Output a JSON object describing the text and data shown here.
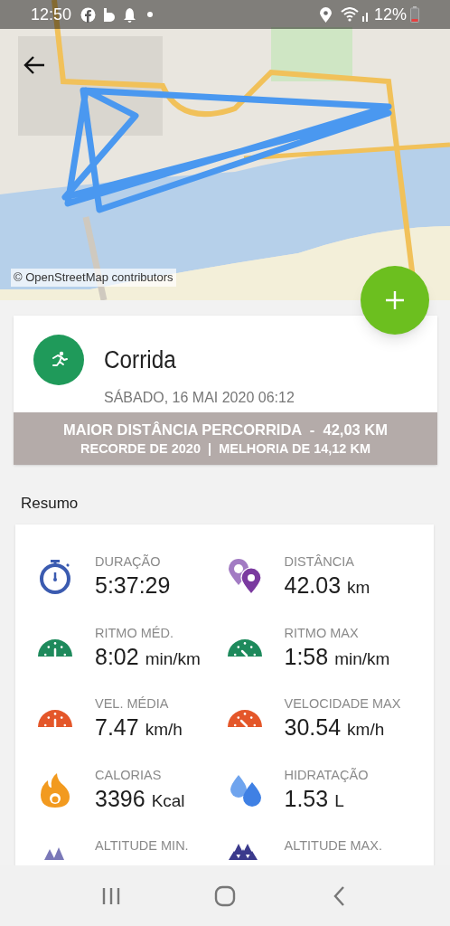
{
  "status_bar": {
    "time": "12:50",
    "battery": "12%"
  },
  "map": {
    "attribution": "© OpenStreetMap contributors"
  },
  "activity": {
    "title": "Corrida",
    "date": "SÁBADO, 16 MAI 2020 06:12",
    "record": {
      "headline": "MAIOR DISTÂNCIA PERCORRIDA  -  42,03 KM",
      "detail": "RECORDE DE 2020  |  MELHORIA DE 14,12 KM"
    }
  },
  "summary": {
    "title": "Resumo",
    "stats": [
      {
        "kind": "duration",
        "label": "DURAÇÃO",
        "value": "5:37:29"
      },
      {
        "kind": "distance",
        "label": "DISTÂNCIA",
        "value": "42.03",
        "unit": "km"
      },
      {
        "kind": "pace",
        "label": "RITMO MÉD.",
        "value": "8:02",
        "unit": "min/km"
      },
      {
        "kind": "pace_max",
        "label": "RITMO MAX",
        "value": "1:58",
        "unit": "min/km"
      },
      {
        "kind": "speed",
        "label": "VEL. MÉDIA",
        "value": "7.47",
        "unit": "km/h"
      },
      {
        "kind": "speed_max",
        "label": "VELOCIDADE MAX",
        "value": "30.54",
        "unit": "km/h"
      },
      {
        "kind": "calories",
        "label": "CALORIAS",
        "value": "3396",
        "unit": "Kcal"
      },
      {
        "kind": "hydration",
        "label": "HIDRATAÇÃO",
        "value": "1.53",
        "unit": "L"
      },
      {
        "kind": "altitude_min",
        "label": "ALTITUDE MIN."
      },
      {
        "kind": "altitude_max",
        "label": "ALTITUDE MAX."
      }
    ]
  }
}
